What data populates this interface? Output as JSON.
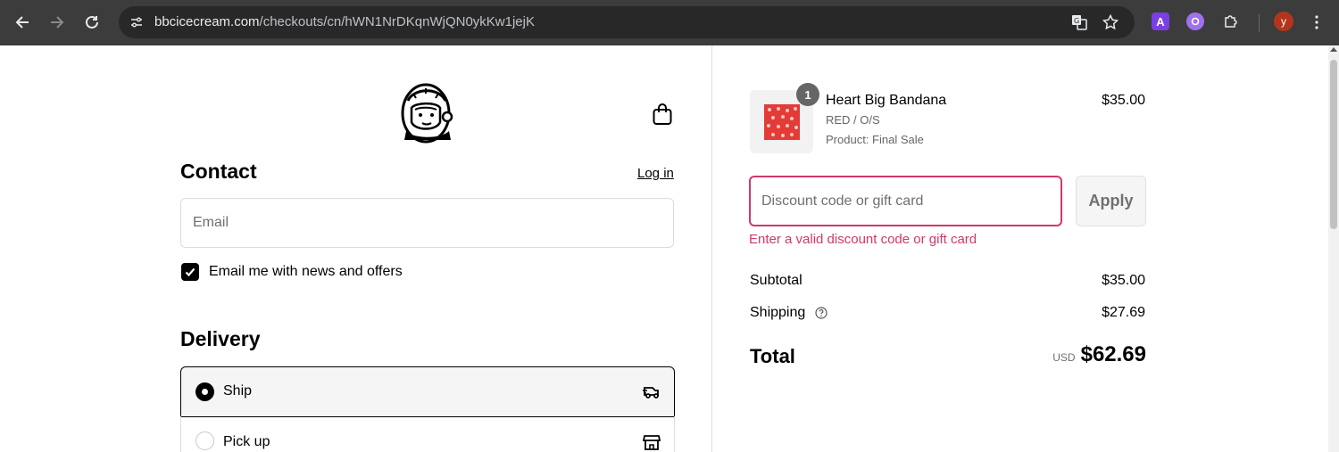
{
  "browser": {
    "url_host": "bbcicecream.com",
    "url_path": "/checkouts/cn/hWN1NrDKqnWjQN0ykKw1jejK",
    "extension_label": "A",
    "profile_initial": "y"
  },
  "header": {
    "brand_logo": "astronaut-helmet-logo",
    "cart_icon": "shopping-bag-icon"
  },
  "contact": {
    "title": "Contact",
    "login_label": "Log in",
    "email_placeholder": "Email",
    "newsletter_label": "Email me with news and offers",
    "newsletter_checked": true
  },
  "delivery": {
    "title": "Delivery",
    "options": [
      {
        "label": "Ship",
        "selected": true,
        "icon": "truck-icon"
      },
      {
        "label": "Pick up",
        "selected": false,
        "icon": "store-icon"
      }
    ]
  },
  "order": {
    "item": {
      "quantity": "1",
      "name": "Heart Big Bandana",
      "variant": "RED / O/S",
      "note": "Product: Final Sale",
      "price": "$35.00"
    },
    "discount": {
      "placeholder": "Discount code or gift card",
      "apply_label": "Apply",
      "error": "Enter a valid discount code or gift card"
    },
    "subtotal_label": "Subtotal",
    "subtotal_value": "$35.00",
    "shipping_label": "Shipping",
    "shipping_value": "$27.69",
    "total_label": "Total",
    "currency": "USD",
    "total_value": "$62.69"
  },
  "colors": {
    "error": "#d2376d",
    "chrome_bg": "#3c3c3c"
  }
}
